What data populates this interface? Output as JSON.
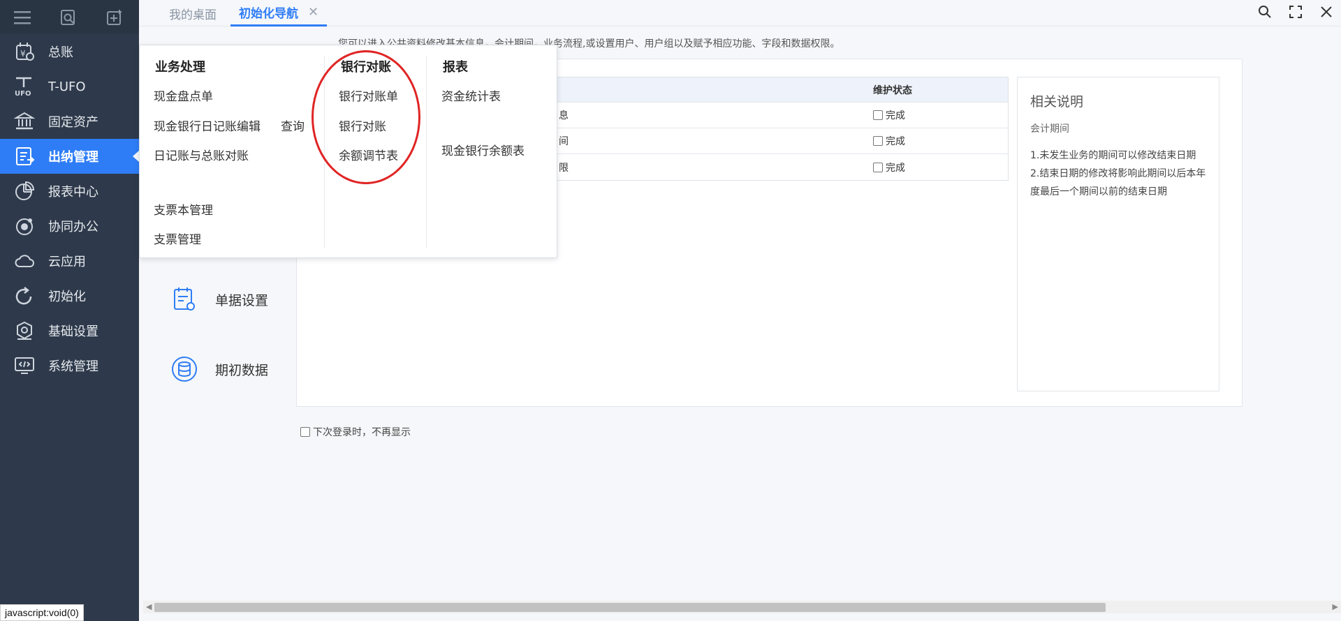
{
  "sidebar": {
    "items": [
      {
        "label": "总账",
        "icon": "ledger-icon"
      },
      {
        "label": "T-UFO",
        "icon": "ufo-icon"
      },
      {
        "label": "固定资产",
        "icon": "bank-icon"
      },
      {
        "label": "出纳管理",
        "icon": "cashier-icon",
        "active": true
      },
      {
        "label": "报表中心",
        "icon": "pie-chart-icon"
      },
      {
        "label": "协同办公",
        "icon": "collab-icon"
      },
      {
        "label": "云应用",
        "icon": "cloud-icon"
      },
      {
        "label": "初始化",
        "icon": "refresh-icon"
      },
      {
        "label": "基础设置",
        "icon": "settings-icon"
      },
      {
        "label": "系统管理",
        "icon": "system-icon"
      }
    ]
  },
  "tabs": [
    {
      "label": "我的桌面",
      "active": false
    },
    {
      "label": "初始化导航",
      "active": true,
      "close": "✕"
    }
  ],
  "hint": "您可以进入公共资料修改基本信息，会计期间，业务流程,或设置用户、用户组以及赋予相应功能、字段和数据权限。",
  "table": {
    "header": {
      "name": "",
      "state": "维护状态"
    },
    "rows": [
      {
        "name": "息",
        "state": "完成"
      },
      {
        "name": "间",
        "state": "完成"
      },
      {
        "name": "限",
        "state": "完成"
      }
    ]
  },
  "side_note": {
    "title": "相关说明",
    "subtitle": "会计期间",
    "p1": "1.未发生业务的期间可以修改结束日期",
    "p2": "2.结束日期的修改将影响此期间以后本年度最后一个期间以前的结束日期"
  },
  "left_cards": [
    {
      "label": "单据设置",
      "icon": "document-settings-icon"
    },
    {
      "label": "期初数据",
      "icon": "database-icon"
    }
  ],
  "no_show": "下次登录时，不再显示",
  "menu": {
    "business": {
      "title": "业务处理",
      "items": [
        "现金盘点单",
        "现金银行日记账编辑",
        "查询",
        "日记账与总账对账",
        "支票本管理",
        "支票管理"
      ]
    },
    "bank": {
      "title": "银行对账",
      "items": [
        "银行对账单",
        "银行对账",
        "余额调节表"
      ]
    },
    "report": {
      "title": "报表",
      "items": [
        "资金统计表",
        "现金银行余额表"
      ]
    }
  },
  "status_bar": "javascript:void(0)",
  "colors": {
    "sidebar_bg": "#2e3a4b",
    "accent": "#2f7df6",
    "highlight_circle": "#e02424"
  }
}
